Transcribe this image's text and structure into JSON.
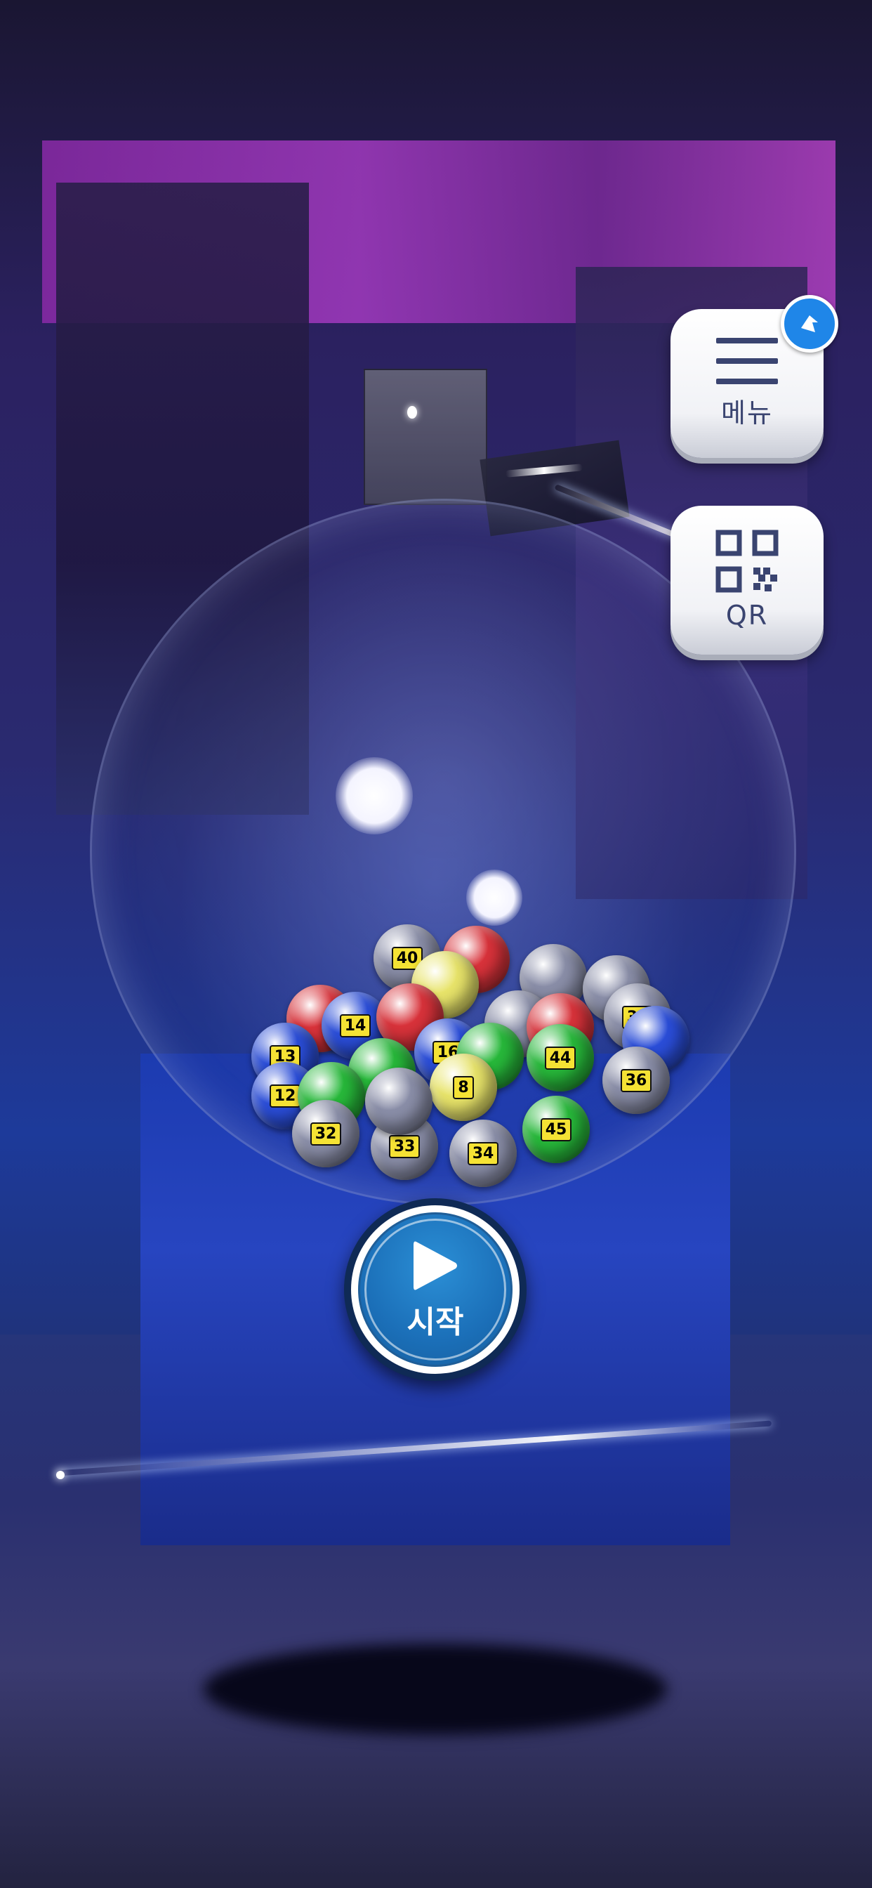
{
  "buttons": {
    "menu_label": "메뉴",
    "qr_label": "QR",
    "start_label": "시작"
  },
  "icons": {
    "menu": "hamburger-icon",
    "qr": "qr-code-icon",
    "start": "play-icon",
    "badge": "notification-badge-icon"
  },
  "balls": [
    {
      "number": "40",
      "color": "gray"
    },
    {
      "number": "",
      "color": "red"
    },
    {
      "number": "",
      "color": "yellow"
    },
    {
      "number": "",
      "color": "gray"
    },
    {
      "number": "",
      "color": "gray"
    },
    {
      "number": "",
      "color": "red"
    },
    {
      "number": "14",
      "color": "blue"
    },
    {
      "number": "",
      "color": "red"
    },
    {
      "number": "",
      "color": "gray"
    },
    {
      "number": "",
      "color": "red"
    },
    {
      "number": "35",
      "color": "gray"
    },
    {
      "number": "13",
      "color": "blue"
    },
    {
      "number": "16",
      "color": "blue"
    },
    {
      "number": "",
      "color": "green"
    },
    {
      "number": "44",
      "color": "green"
    },
    {
      "number": "",
      "color": "blue"
    },
    {
      "number": "12",
      "color": "blue"
    },
    {
      "number": "8",
      "color": "yellow"
    },
    {
      "number": "",
      "color": "green"
    },
    {
      "number": "36",
      "color": "gray"
    },
    {
      "number": "",
      "color": "green"
    },
    {
      "number": "32",
      "color": "gray"
    },
    {
      "number": "33",
      "color": "gray"
    },
    {
      "number": "34",
      "color": "gray"
    },
    {
      "number": "45",
      "color": "green"
    },
    {
      "number": "",
      "color": "gray"
    }
  ],
  "colors": {
    "ball_yellow": "#e8e46a",
    "ball_red": "#d8323a",
    "ball_blue": "#2a4dd8",
    "ball_green": "#27b83a",
    "ball_gray": "#8a8ea8",
    "start_blue": "#1b6fb8",
    "button_text": "#3a4470",
    "badge_blue": "#1f86e8"
  }
}
